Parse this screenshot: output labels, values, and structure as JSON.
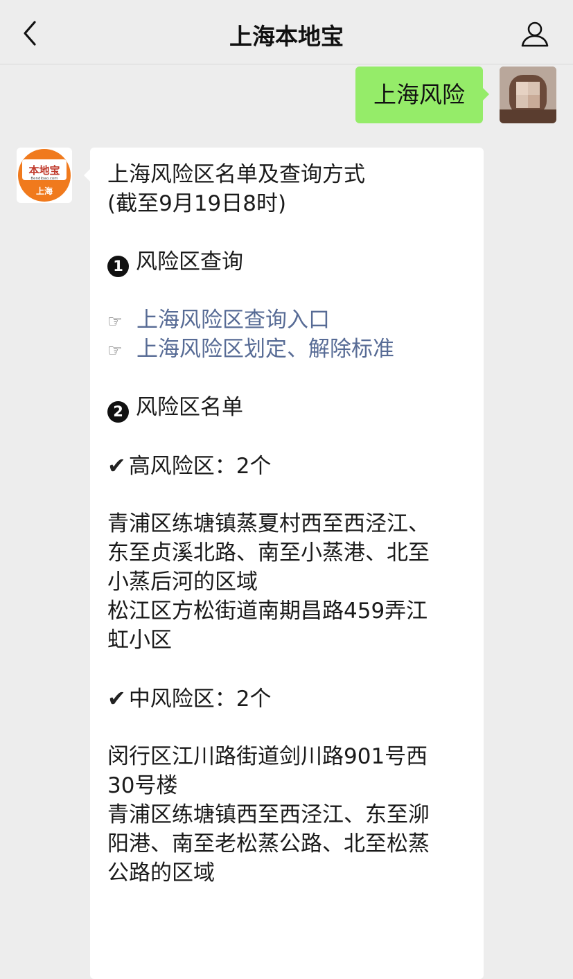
{
  "header": {
    "title": "上海本地宝",
    "back_icon": "chevron-left-icon",
    "profile_icon": "person-icon"
  },
  "outgoing": {
    "text": "上海风险"
  },
  "bot": {
    "avatar_top": "本地宝",
    "avatar_mid": "Bendibao.com",
    "avatar_bottom": "上海",
    "brand_color": "#f07a1d"
  },
  "reply": {
    "title_line1": "上海风险区名单及查询方式",
    "title_line2": "(截至9月19日8时)",
    "section1_num": "1",
    "section1_label": "风险区查询",
    "link1": "上海风险区查询入口",
    "link2": "上海风险区划定、解除标准",
    "section2_num": "2",
    "section2_label": "风险区名单",
    "high_label": "高风险区：2个",
    "high_lines": [
      "青浦区练塘镇蒸夏村西至西泾江、",
      "东至贞溪北路、南至小蒸港、北至",
      "小蒸后河的区域",
      "松江区方松街道南期昌路459弄江",
      "虹小区"
    ],
    "mid_label": "中风险区：2个",
    "mid_lines": [
      "闵行区江川路街道剑川路901号西",
      "30号楼",
      "青浦区练塘镇西至西泾江、东至泖",
      "阳港、南至老松蒸公路、北至松蒸",
      "公路的区域"
    ],
    "hand_icon": "☞",
    "check_icon": "✔"
  }
}
